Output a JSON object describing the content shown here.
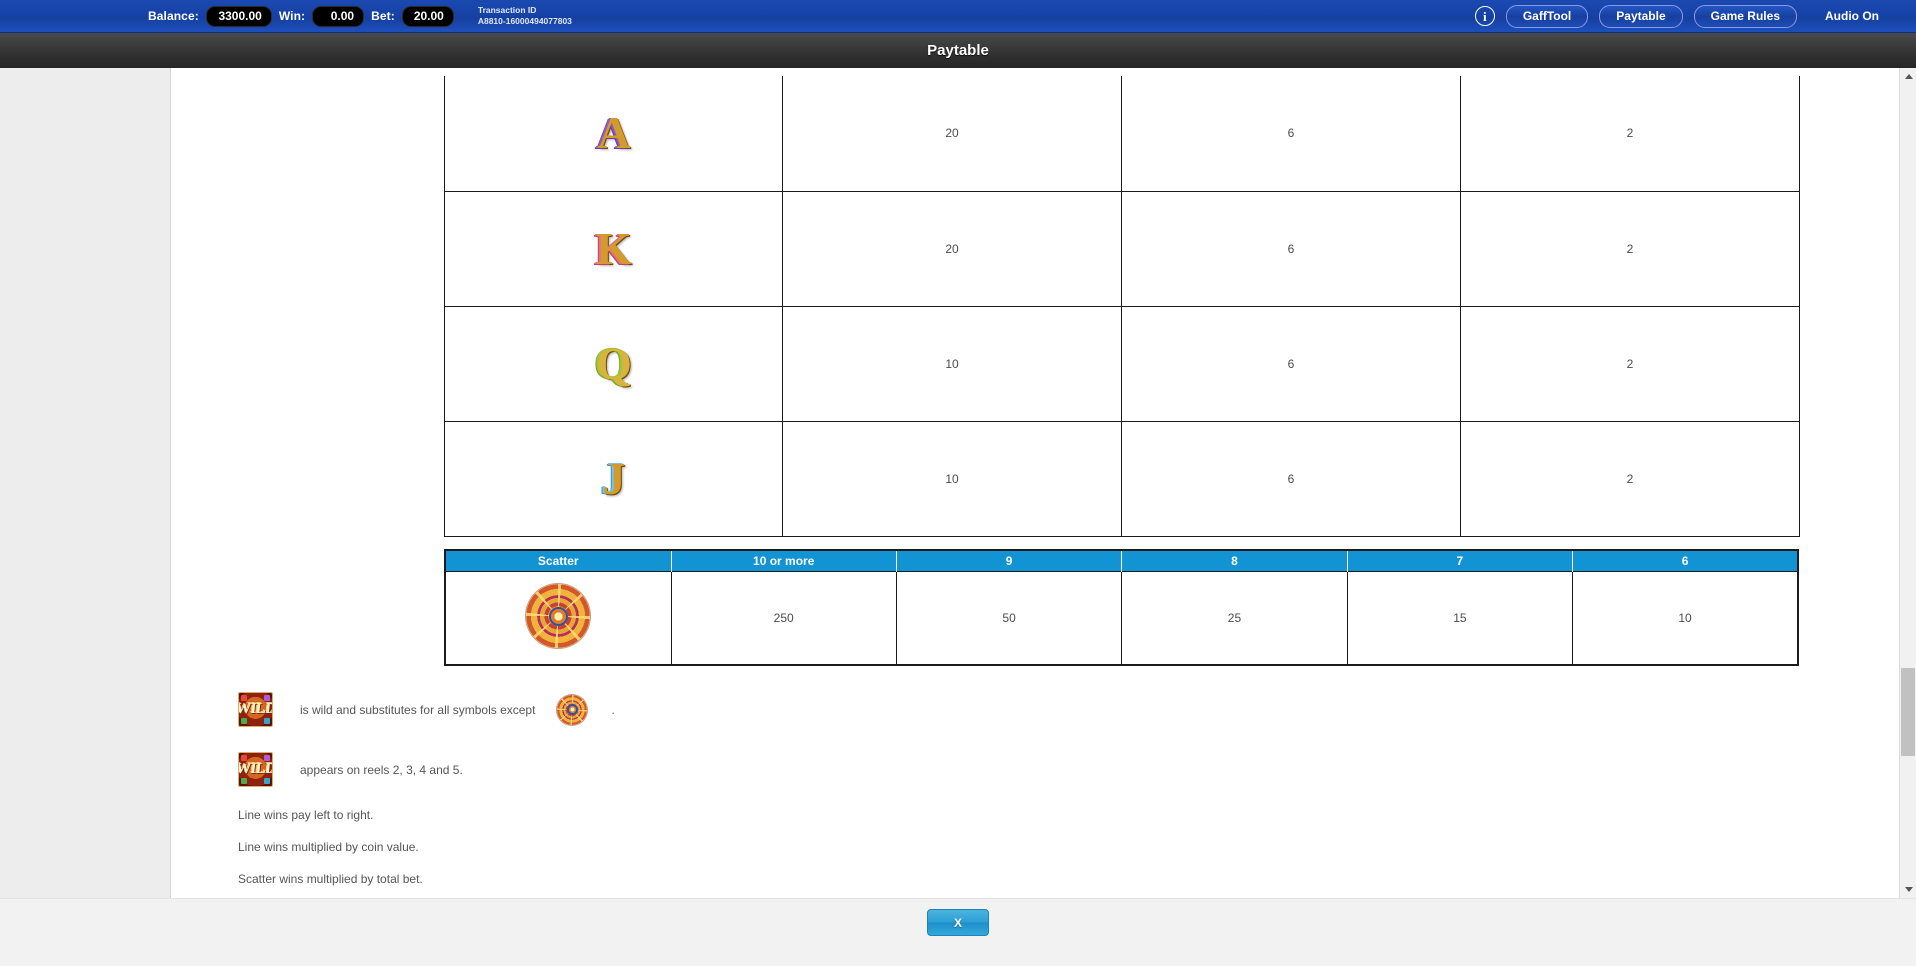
{
  "topbar": {
    "balance_label": "Balance:",
    "balance_value": "3300.00",
    "win_label": "Win:",
    "win_value": "0.00",
    "bet_label": "Bet:",
    "bet_value": "20.00",
    "transaction_title": "Transaction ID",
    "transaction_id": "A8810-16000494077803",
    "info_glyph": "i",
    "buttons": [
      {
        "label": "GaffTool"
      },
      {
        "label": "Paytable"
      },
      {
        "label": "Game Rules"
      },
      {
        "label": "Audio On"
      }
    ],
    "accent_color": "#1743a8"
  },
  "title": "Paytable",
  "paytable": {
    "rows": [
      {
        "symbol": "A",
        "symbol_class": "glyph-a",
        "values": [
          "20",
          "6",
          "2"
        ]
      },
      {
        "symbol": "K",
        "symbol_class": "glyph-k",
        "values": [
          "20",
          "6",
          "2"
        ]
      },
      {
        "symbol": "Q",
        "symbol_class": "glyph-q",
        "values": [
          "10",
          "6",
          "2"
        ]
      },
      {
        "symbol": "J",
        "symbol_class": "glyph-j",
        "values": [
          "10",
          "6",
          "2"
        ]
      }
    ]
  },
  "scatter_table": {
    "headers": [
      "Scatter",
      "10 or more",
      "9",
      "8",
      "7",
      "6"
    ],
    "symbol_name": "scatter-wheel-symbol",
    "values": [
      "250",
      "50",
      "25",
      "15",
      "10"
    ],
    "header_color": "#1193d4"
  },
  "notes": [
    {
      "icon": "wild-symbol",
      "text": "is wild and substitutes for all symbols except",
      "trailing_icon": "scatter-wheel-symbol",
      "period": "."
    },
    {
      "icon": "wild-symbol",
      "text": "appears on reels 2, 3, 4 and 5."
    }
  ],
  "wild_label": "WILD",
  "rules": [
    "Line wins pay left to right.",
    "Line wins multiplied by coin value.",
    "Scatter wins multiplied by total bet."
  ],
  "footer": {
    "close_label": "X"
  }
}
